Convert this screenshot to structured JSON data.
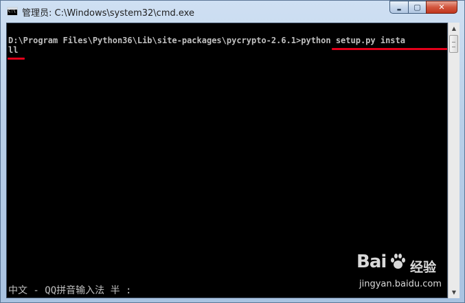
{
  "window": {
    "title": "管理员: C:\\Windows\\system32\\cmd.exe",
    "icon": "cmd-icon",
    "controls": {
      "minimize": "▬",
      "maximize": "▢",
      "close": "✕"
    }
  },
  "console": {
    "line1": "D:\\Program Files\\Python36\\Lib\\site-packages\\pycrypto-2.6.1>python setup.py insta",
    "line2": "ll",
    "ime_status": "中文 - QQ拼音输入法 半 :",
    "background": "#000000",
    "text_color": "#c0c0c0",
    "annotation_color": "#e4001a"
  },
  "scrollbar": {
    "up_arrow": "▲",
    "down_arrow": "▼"
  },
  "watermark": {
    "logo": "Bai",
    "logo_suffix": "经验",
    "url": "jingyan.baidu.com"
  }
}
